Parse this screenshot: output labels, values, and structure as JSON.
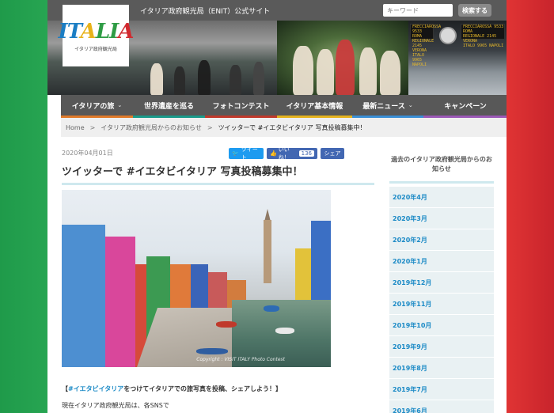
{
  "header": {
    "site_title": "イタリア政府観光局（ENIT）公式サイト",
    "logo_text": "ITALIA",
    "logo_sub": "イタリア政府観光局",
    "search_placeholder": "キーワード",
    "search_button": "検索する"
  },
  "hero": {
    "board_lines": [
      "FRECCIAROSSA 9533 ROMA",
      "REGIONALE 2145 VERONA",
      "ITALO 9965 NAPOLI"
    ]
  },
  "nav": {
    "items": [
      {
        "label": "イタリアの旅",
        "has_chevron": true,
        "color": "#e07a2a"
      },
      {
        "label": "世界遺産を巡る",
        "has_chevron": false,
        "color": "#1a9a8a"
      },
      {
        "label": "フォトコンテスト",
        "has_chevron": false,
        "color": "#c0392b"
      },
      {
        "label": "イタリア基本情報",
        "has_chevron": false,
        "color": "#e6b31e"
      },
      {
        "label": "最新ニュース",
        "has_chevron": true,
        "color": "#3b8fd6"
      },
      {
        "label": "キャンペーン",
        "has_chevron": false,
        "color": "#9b59b6"
      }
    ],
    "chevron": "⌄"
  },
  "breadcrumb": {
    "home": "Home",
    "sep": ">",
    "parent": "イタリア政府観光局からのお知らせ",
    "current": "ツイッターで #イエタビイタリア 写真投稿募集中！"
  },
  "post": {
    "date": "2020年04月01日",
    "tweet_label": "ツイート",
    "like_label": "いいね！",
    "like_count": "136",
    "share_label": "シェア",
    "title": "ツイッターで #イエタビイタリア 写真投稿募集中！",
    "photo_credit": "Copyright : VISIT ITALY Photo Contest",
    "caption_open": "【",
    "caption_hashtag": "#イエタビイタリア",
    "caption_rest": "をつけてイタリアでの旅写真を投稿、シェアしよう！】",
    "body_start": "現在イタリア政府観光局は、各SNSで"
  },
  "sidebar": {
    "heading": "過去のイタリア政府観光局からのお知らせ",
    "months": [
      "2020年4月",
      "2020年3月",
      "2020年2月",
      "2020年1月",
      "2019年12月",
      "2019年11月",
      "2019年10月",
      "2019年9月",
      "2019年8月",
      "2019年7月",
      "2019年6月"
    ]
  },
  "colors": {
    "accent_blue": "#1b8ac6",
    "twitter": "#1d9bf0",
    "facebook": "#4267b2",
    "flag_green": "#27a552",
    "flag_red": "#d12a2f"
  }
}
